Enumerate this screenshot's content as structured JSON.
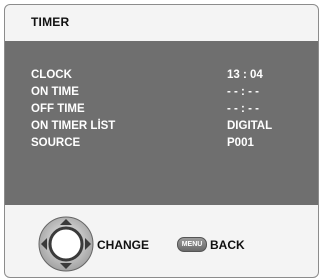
{
  "title": "TIMER",
  "settings": [
    {
      "label": "CLOCK",
      "value": "13 : 04"
    },
    {
      "label": "ON TIME",
      "value": "- - : - -"
    },
    {
      "label": "OFF TIME",
      "value": "- - : - -"
    },
    {
      "label": "ON TIMER LİST",
      "value": "DIGITAL"
    },
    {
      "label": "SOURCE",
      "value": "P001"
    }
  ],
  "footer": {
    "change_label": "CHANGE",
    "menu_key": "MENU",
    "back_label": "BACK",
    "nav_icon": "four-way-navigation-icon"
  },
  "colors": {
    "panel": "#6f6f6f",
    "frame_bg": "#f4f4f4",
    "text_on_panel": "#ffffff"
  }
}
